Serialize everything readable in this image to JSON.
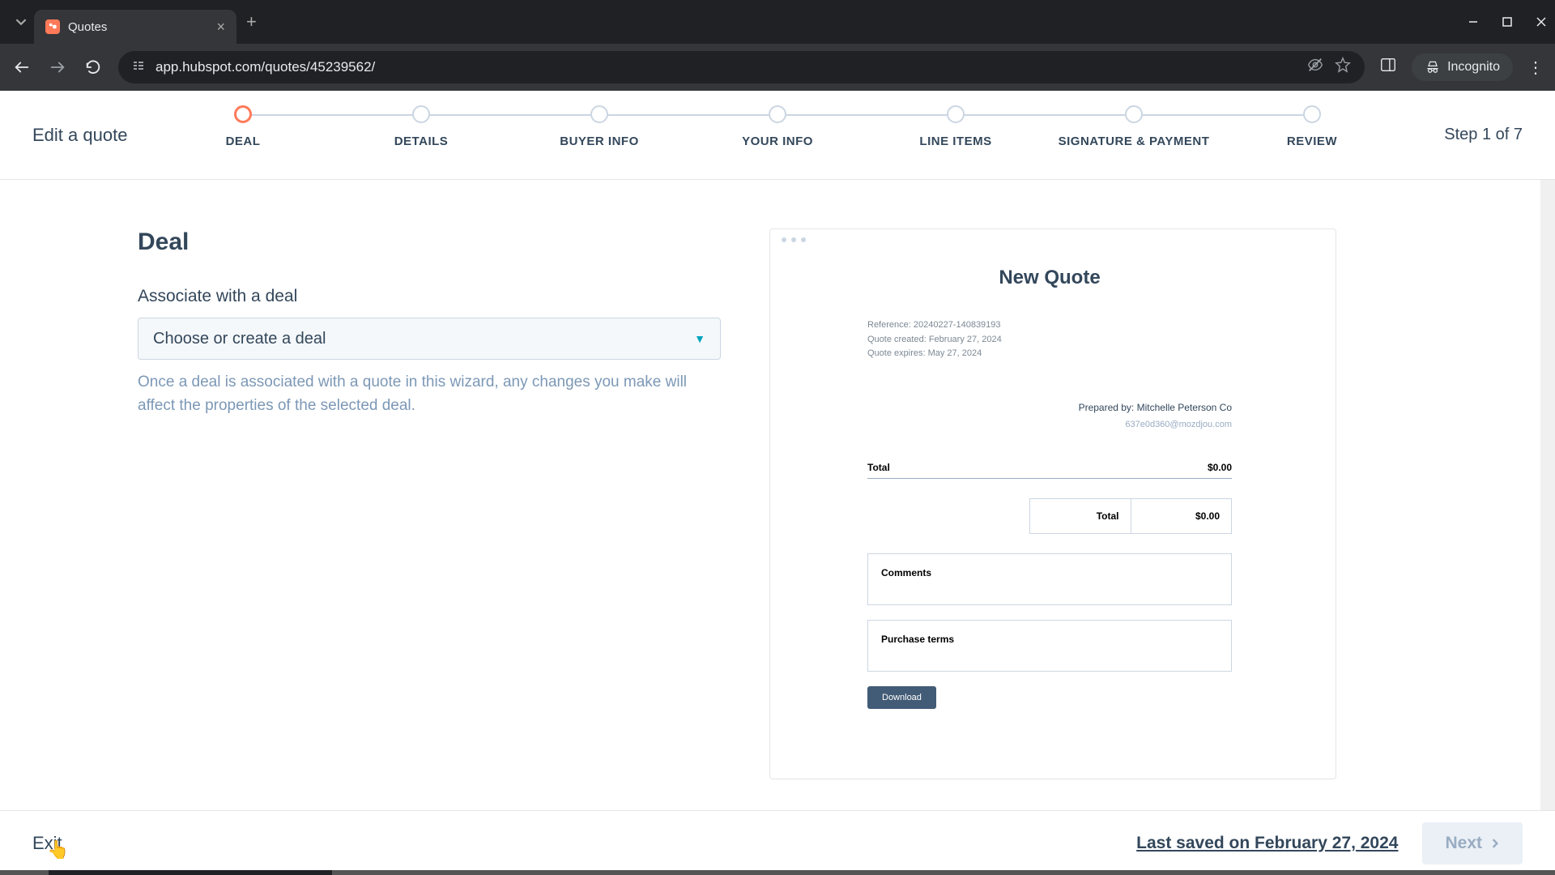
{
  "browser": {
    "tab_title": "Quotes",
    "url": "app.hubspot.com/quotes/45239562/",
    "incognito_label": "Incognito"
  },
  "header": {
    "title": "Edit a quote",
    "step_indicator": "Step 1 of 7",
    "steps": [
      {
        "label": "DEAL"
      },
      {
        "label": "DETAILS"
      },
      {
        "label": "BUYER INFO"
      },
      {
        "label": "YOUR INFO"
      },
      {
        "label": "LINE ITEMS"
      },
      {
        "label": "SIGNATURE & PAYMENT"
      },
      {
        "label": "REVIEW"
      }
    ]
  },
  "main": {
    "section_title": "Deal",
    "field_label": "Associate with a deal",
    "select_placeholder": "Choose or create a deal",
    "helper_text": "Once a deal is associated with a quote in this wizard, any changes you make will affect the properties of the selected deal."
  },
  "preview": {
    "title": "New Quote",
    "reference": "Reference: 20240227-140839193",
    "created": "Quote created: February 27, 2024",
    "expires": "Quote expires: May 27, 2024",
    "prepared_by": "Prepared by: Mitchelle Peterson Co",
    "email": "637e0d360@mozdjou.com",
    "total_label": "Total",
    "total_value": "$0.00",
    "box_total_label": "Total",
    "box_total_value": "$0.00",
    "comments_label": "Comments",
    "terms_label": "Purchase terms",
    "download_label": "Download"
  },
  "footer": {
    "exit_label": "Exit",
    "last_saved": "Last saved on February 27, 2024",
    "next_label": "Next"
  }
}
